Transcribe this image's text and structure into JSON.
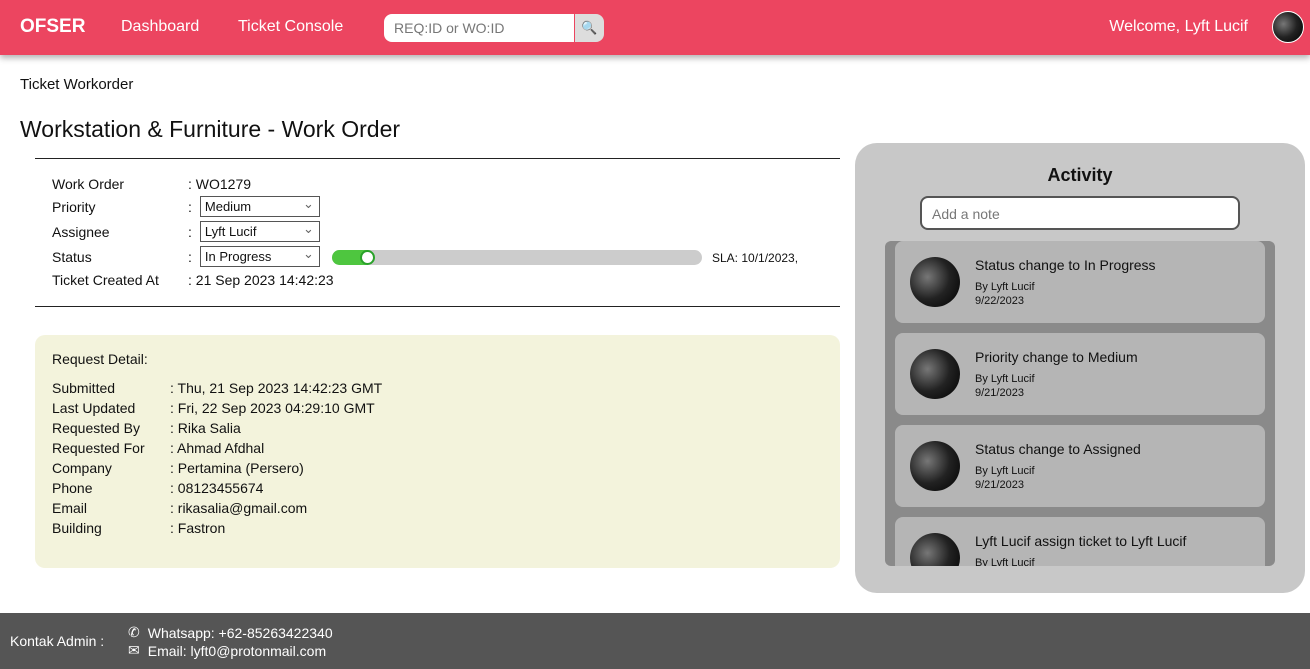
{
  "nav": {
    "logo": "OFSER",
    "links": [
      "Dashboard",
      "Ticket Console"
    ],
    "search_placeholder": "REQ:ID or WO:ID",
    "welcome": "Welcome, Lyft Lucif"
  },
  "page": {
    "breadcrumb": "Ticket Workorder",
    "title": "Workstation & Furniture - Work Order"
  },
  "ticket": {
    "work_order": {
      "label": "Work Order",
      "value": ": WO1279"
    },
    "priority": {
      "label": "Priority",
      "value": "Medium"
    },
    "assignee": {
      "label": "Assignee",
      "value": "Lyft Lucif"
    },
    "status": {
      "label": "Status",
      "value": "In Progress",
      "progress_percent": 11,
      "sla": "SLA: 10/1/2023,"
    },
    "created": {
      "label": "Ticket Created At",
      "value": ": 21 Sep 2023 14:42:23"
    },
    "sep": ":"
  },
  "detail": {
    "heading": "Request Detail:",
    "rows": [
      {
        "label": "Submitted",
        "value": ": Thu, 21 Sep 2023 14:42:23 GMT"
      },
      {
        "label": "Last Updated",
        "value": ": Fri, 22 Sep 2023 04:29:10 GMT"
      },
      {
        "label": "Requested By",
        "value": ": Rika Salia"
      },
      {
        "label": "Requested For",
        "value": ": Ahmad Afdhal"
      },
      {
        "label": "Company",
        "value": ": Pertamina (Persero)"
      },
      {
        "label": "Phone",
        "value": ": 08123455674"
      },
      {
        "label": "Email",
        "value": ": rikasalia@gmail.com"
      },
      {
        "label": "Building",
        "value": ": Fastron"
      }
    ]
  },
  "activity": {
    "title": "Activity",
    "note_placeholder": "Add a note",
    "items": [
      {
        "text": "Status change to In Progress",
        "by": "By Lyft Lucif",
        "date": "9/22/2023"
      },
      {
        "text": "Priority change to Medium",
        "by": "By Lyft Lucif",
        "date": "9/21/2023"
      },
      {
        "text": "Status change to Assigned",
        "by": "By Lyft Lucif",
        "date": "9/21/2023"
      },
      {
        "text": "Lyft Lucif assign ticket to Lyft Lucif",
        "by": "By Lyft Lucif",
        "date": ""
      }
    ]
  },
  "footer": {
    "label": "Kontak Admin :",
    "whatsapp": "Whatsapp: +62-85263422340",
    "email": "Email: lyft0@protonmail.com"
  },
  "colors": {
    "brand": "#ec4560",
    "progress": "#4ec63f"
  }
}
